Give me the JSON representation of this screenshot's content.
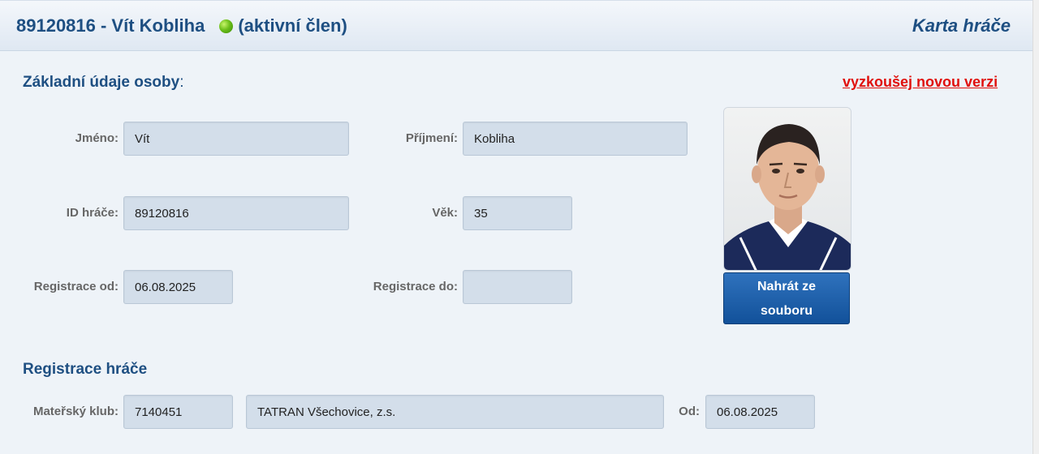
{
  "header": {
    "title": "89120816 - Vít Kobliha",
    "status": "(aktivní člen)",
    "status_color": "#6cbf1a",
    "card_title": "Karta hráče"
  },
  "basic": {
    "section_title": "Základní údaje osoby",
    "colon": ":",
    "new_version_link": "vyzkoušej novou verzi",
    "first_name_label": "Jméno:",
    "first_name": "Vít",
    "last_name_label": "Příjmení:",
    "last_name": "Kobliha",
    "player_id_label": "ID hráče:",
    "player_id": "89120816",
    "age_label": "Věk:",
    "age": "35",
    "reg_from_label": "Registrace od:",
    "reg_from": "06.08.2025",
    "reg_to_label": "Registrace do:",
    "reg_to": ""
  },
  "photo": {
    "upload_line1": "Nahrát ze",
    "upload_line2": "souboru"
  },
  "registration": {
    "section_title": "Registrace hráče",
    "club_label": "Mateřský klub:",
    "club_id": "7140451",
    "club_name": "TATRAN Všechovice, z.s.",
    "from_label": "Od:",
    "from": "06.08.2025"
  },
  "colors": {
    "accent": "#1e4f82",
    "link": "#e0100c",
    "button": "#1a5ba6"
  }
}
